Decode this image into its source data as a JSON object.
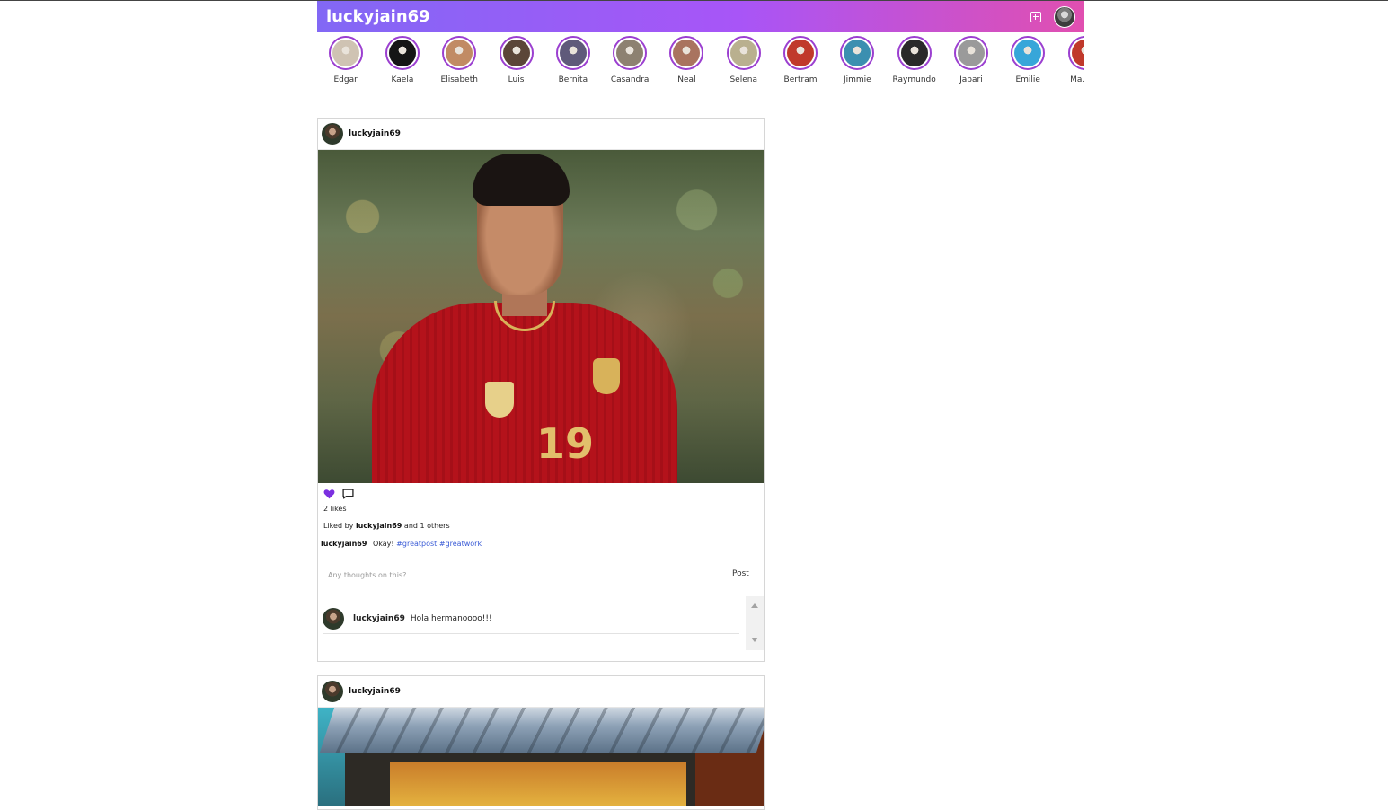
{
  "app": {
    "brand": "luckyjain69"
  },
  "header": {
    "add_icon": "plus-square-icon",
    "avatar_icon": "profile-avatar"
  },
  "stories": [
    {
      "name": "Edgar",
      "color": "#cfc3b3"
    },
    {
      "name": "Kaela",
      "color": "#151515"
    },
    {
      "name": "Elisabeth",
      "color": "#c18b64"
    },
    {
      "name": "Luis",
      "color": "#5b4638"
    },
    {
      "name": "Bernita",
      "color": "#5f5a7a"
    },
    {
      "name": "Casandra",
      "color": "#8d8171"
    },
    {
      "name": "Neal",
      "color": "#a9745f"
    },
    {
      "name": "Selena",
      "color": "#b9b08f"
    },
    {
      "name": "Bertram",
      "color": "#c0392b"
    },
    {
      "name": "Jimmie",
      "color": "#3b8fb0"
    },
    {
      "name": "Raymundo",
      "color": "#2a2a2a"
    },
    {
      "name": "Jabari",
      "color": "#9a9a9a"
    },
    {
      "name": "Emilie",
      "color": "#37a6d9"
    },
    {
      "name": "Maudie",
      "color": "#c0392b"
    }
  ],
  "posts": [
    {
      "user": "luckyjain69",
      "likes_text": "2 likes",
      "liked_by_prefix": "Liked by",
      "liked_by_user": "luckyjain69",
      "liked_by_suffix": "and 1 others",
      "caption_user": "luckyjain69",
      "caption_text": "Okay!",
      "hashtags": [
        "#greatpost",
        "#greatwork"
      ],
      "comment_placeholder": "Any thoughts on this?",
      "post_button": "Post",
      "comments": [
        {
          "user": "luckyjain69",
          "text": "Hola hermanoooo!!!"
        }
      ],
      "jersey_number": "19"
    },
    {
      "user": "luckyjain69"
    }
  ],
  "colors": {
    "header_gradient_start": "#8268f5",
    "header_gradient_end": "#e14fb0",
    "story_ring": "#9b3fd0",
    "like_heart": "#7b2fe0",
    "hashtag": "#3a5bd6"
  }
}
